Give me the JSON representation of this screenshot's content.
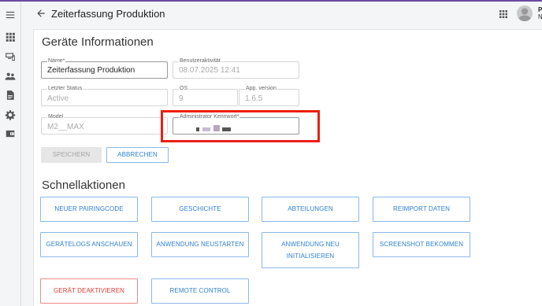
{
  "header": {
    "title": "Zeiterfassung Produktion",
    "user_initial": "P",
    "user_initial_sub": "N"
  },
  "sidebar": {
    "items": [
      {
        "icon": "menu-icon"
      },
      {
        "icon": "apps-grid-icon"
      },
      {
        "icon": "devices-icon"
      },
      {
        "icon": "people-icon"
      },
      {
        "icon": "document-icon"
      },
      {
        "icon": "gear-icon"
      },
      {
        "icon": "wallet-icon"
      }
    ]
  },
  "device_info": {
    "title": "Geräte Informationen",
    "name": {
      "label": "Name*",
      "value": "Zeiterfassung Produktion"
    },
    "user_activity": {
      "label": "Benutzeraktivität",
      "value": "08.07.2025 12:41"
    },
    "last_status": {
      "label": "Letzter Status",
      "value": "Active"
    },
    "os": {
      "label": "OS",
      "value": "9"
    },
    "app_version": {
      "label": "App. version",
      "value": "1.6.5"
    },
    "model": {
      "label": "Model",
      "value": "M2__MAX"
    },
    "admin_password": {
      "label": "Administrator Kennwort*"
    },
    "save_label": "SPEICHERN",
    "cancel_label": "ABBRECHEN"
  },
  "quick_actions": {
    "title": "Schnellaktionen",
    "buttons": {
      "new_pairing": "NEUER PAIRINGCODE",
      "history": "GESCHICHTE",
      "departments": "ABTEILUNGEN",
      "reimport": "REIMPORT DATEN",
      "device_logs": "GERÄTELOGS ANSCHAUEN",
      "restart_app": "ANWENDUNG NEUSTARTEN",
      "reinit_app_line1": "ANWENDUNG NEU",
      "reinit_app_line2": "INITIALISIEREN",
      "screenshot": "SCREENSHOT BEKOMMEN",
      "deactivate": "GERÄT DEAKTIVIEREN",
      "remote_control": "REMOTE CONTROL"
    }
  },
  "colors": {
    "accent": "#2f80d6",
    "danger": "#e23a2e",
    "highlight_frame": "#ec1f10",
    "top_bar": "#6b4aa0"
  }
}
